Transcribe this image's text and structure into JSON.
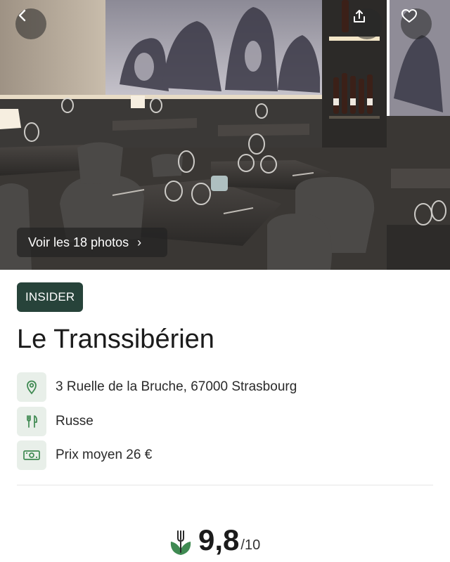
{
  "gallery": {
    "see_photos_label": "Voir les 18 photos",
    "chevron": "›"
  },
  "badge": {
    "label": "INSIDER",
    "color": "#27433a"
  },
  "restaurant": {
    "name": "Le Transsibérien",
    "address": "3 Ruelle de la Bruche, 67000 Strasbourg",
    "cuisine": "Russe",
    "average_price": "Prix moyen 26 €"
  },
  "rating": {
    "value": "9,8",
    "scale": "/10"
  },
  "icons": {
    "back": "chevron-left-icon",
    "share": "share-icon",
    "favorite": "heart-icon",
    "address": "location-pin-icon",
    "cuisine": "fork-knife-icon",
    "price": "banknote-icon",
    "rating": "fork-leaf-logo-icon"
  },
  "colors": {
    "accent_green": "#3f8a52",
    "icon_bg": "#e8efe9",
    "badge_green": "#27433a"
  }
}
